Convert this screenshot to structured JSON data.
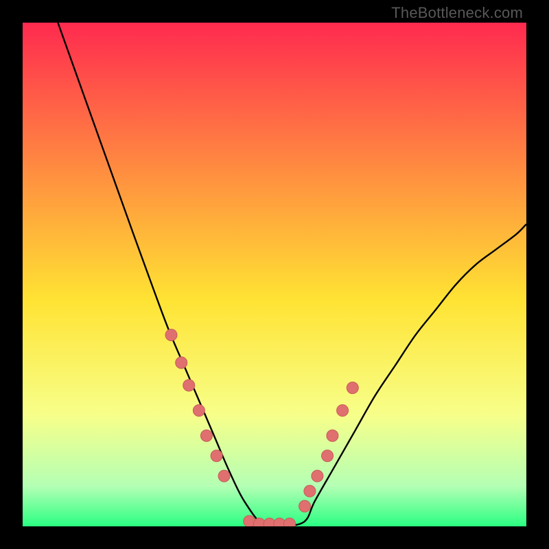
{
  "watermark": "TheBottleneck.com",
  "colors": {
    "background": "#000000",
    "gradient_top": "#ff2a4f",
    "gradient_mid": "#ffe333",
    "gradient_low1": "#f7ff8a",
    "gradient_low2": "#b4ffb4",
    "gradient_bottom": "#2aff82",
    "curve": "#000000",
    "dot_fill": "#df706f",
    "dot_stroke": "#c85a58"
  },
  "chart_data": {
    "type": "line",
    "title": "",
    "xlabel": "",
    "ylabel": "",
    "xlim": [
      0,
      100
    ],
    "ylim": [
      0,
      100
    ],
    "series": [
      {
        "name": "bottleneck-curve",
        "x": [
          7,
          12,
          17,
          22,
          26,
          29,
          32,
          35,
          38,
          41,
          44,
          48,
          52,
          56,
          58,
          62,
          66,
          70,
          74,
          78,
          82,
          86,
          90,
          94,
          98,
          100
        ],
        "y": [
          100,
          86,
          72,
          58,
          47,
          39,
          32,
          25,
          18,
          11,
          5,
          0,
          0,
          1,
          5,
          12,
          19,
          26,
          32,
          38,
          43,
          48,
          52,
          55,
          58,
          60
        ]
      }
    ],
    "dots": {
      "name": "highlight-points",
      "x": [
        29.5,
        31.5,
        33.0,
        35.0,
        36.5,
        38.5,
        40.0,
        45.0,
        47.0,
        49.0,
        51.0,
        53.0,
        56.0,
        57.0,
        58.5,
        60.5,
        61.5,
        63.5,
        65.5
      ],
      "y": [
        38.0,
        32.5,
        28.0,
        23.0,
        18.0,
        14.0,
        10.0,
        1.0,
        0.5,
        0.5,
        0.5,
        0.5,
        4.0,
        7.0,
        10.0,
        14.0,
        18.0,
        23.0,
        27.5
      ]
    }
  }
}
